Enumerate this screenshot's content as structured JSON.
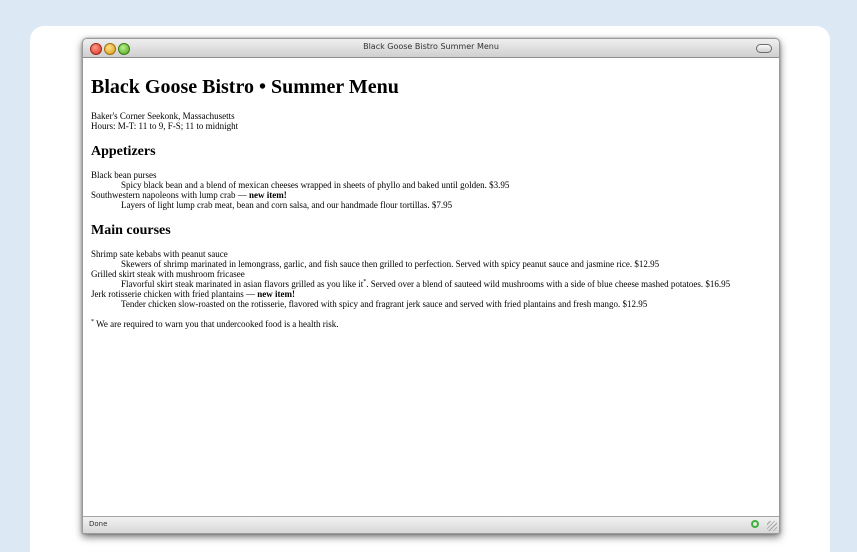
{
  "window": {
    "title": "Black Goose Bistro Summer Menu",
    "status": "Done"
  },
  "page": {
    "heading": "Black Goose Bistro • Summer Menu",
    "address": "Baker's Corner Seekonk, Massachusetts",
    "hours": "Hours: M-T: 11 to 9, F-S; 11 to midnight",
    "appetizers_heading": "Appetizers",
    "appetizers": [
      {
        "name": "Black bean purses",
        "desc": "Spicy black bean and a blend of mexican cheeses wrapped in sheets of phyllo and baked until golden. $3.95"
      },
      {
        "name": "Southwestern napoleons with lump crab —",
        "badge": "new item!",
        "desc": "Layers of light lump crab meat, bean and corn salsa, and our handmade flour tortillas. $7.95"
      }
    ],
    "main_heading": "Main courses",
    "mains": [
      {
        "name": "Shrimp sate kebabs with peanut sauce",
        "desc": "Skewers of shrimp marinated in lemongrass, garlic, and fish sauce then grilled to perfection. Served with spicy peanut sauce and jasmine rice. $12.95"
      },
      {
        "name": "Grilled skirt steak with mushroom fricasee",
        "desc_pre": "Flavorful skirt steak marinated in asian flavors grilled as you like it",
        "desc_mark": "*",
        "desc_post": ". Served over a blend of sauteed wild mushrooms with a side of blue cheese mashed potatoes. $16.95"
      },
      {
        "name": "Jerk rotisserie chicken with fried plantains —",
        "badge": "new item!",
        "desc": "Tender chicken slow-roasted on the rotisserie, flavored with spicy and fragrant jerk sauce and served with fried plantains and fresh mango. $12.95"
      }
    ],
    "footnote_mark": "*",
    "footnote": " We are required to warn you that undercooked food is a health risk."
  }
}
